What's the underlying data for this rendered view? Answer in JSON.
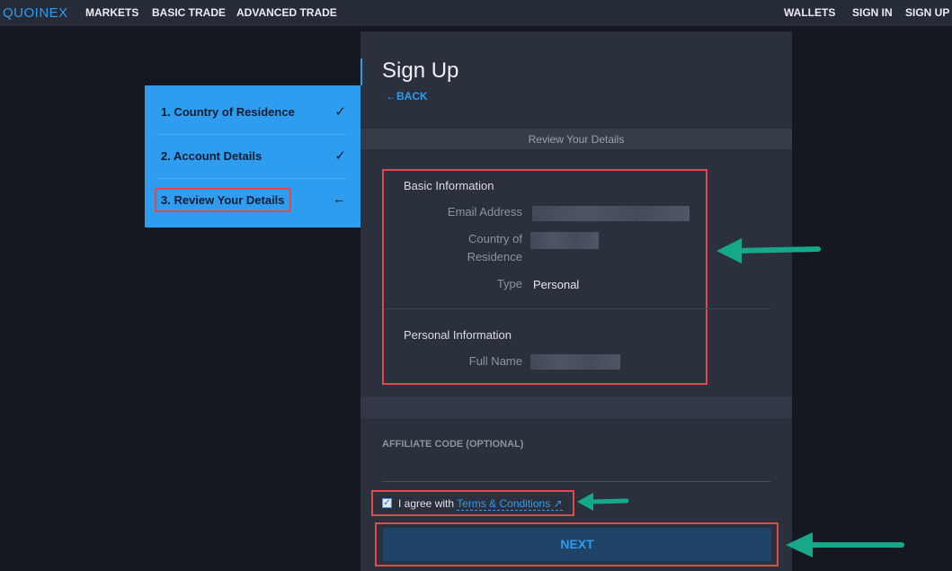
{
  "nav": {
    "logo": "QUOINEX",
    "links_left": [
      "MARKETS",
      "BASIC TRADE",
      "ADVANCED TRADE"
    ],
    "links_right": [
      "WALLETS",
      "SIGN IN",
      "SIGN UP"
    ]
  },
  "steps": [
    {
      "label": "1. Country of Residence",
      "mark": "✓"
    },
    {
      "label": "2. Account Details",
      "mark": "✓"
    },
    {
      "label": "3. Review Your Details",
      "mark": "←"
    }
  ],
  "header": {
    "title": "Sign Up",
    "back": "←BACK"
  },
  "review_bar": "Review Your Details",
  "basic_info": {
    "title": "Basic Information",
    "email_label": "Email Address",
    "country_label_1": "Country of",
    "country_label_2": "Residence",
    "type_label": "Type",
    "type_value": "Personal"
  },
  "personal_info": {
    "title": "Personal Information",
    "full_name_label": "Full Name"
  },
  "affiliate": {
    "label": "AFFILIATE CODE (OPTIONAL)",
    "value": ""
  },
  "agree": {
    "prefix": "I agree with ",
    "link": "Terms & Conditions ↗",
    "checked": true
  },
  "next_label": "NEXT",
  "colors": {
    "accent": "#2d9cf0",
    "highlight_box": "#e0484c",
    "annotation_arrow": "#17a88a"
  }
}
